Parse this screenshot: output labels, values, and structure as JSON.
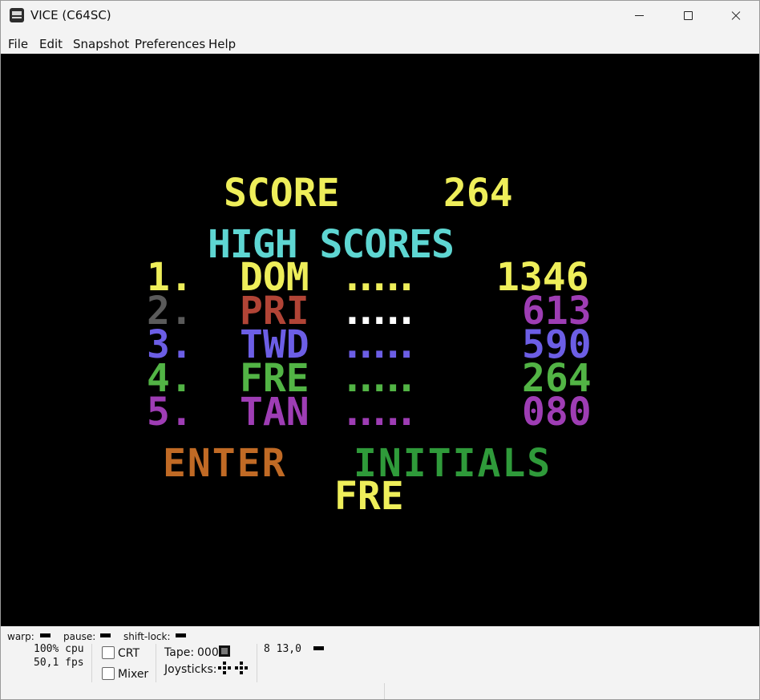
{
  "window": {
    "title": "VICE (C64SC)"
  },
  "menu": [
    "File",
    "Edit",
    "Snapshot",
    "Preferences",
    "Help"
  ],
  "screen": {
    "score_label": "SCORE",
    "score_value": "264",
    "heading": "HIGH SCORES",
    "rows": [
      {
        "rank": "1.",
        "name": "DOM",
        "dots": ".....",
        "score": "1346"
      },
      {
        "rank": "2.",
        "name": "PRI",
        "dots": ".....",
        "score": "613"
      },
      {
        "rank": "3.",
        "name": "TWD",
        "dots": ".....",
        "score": "590"
      },
      {
        "rank": "4.",
        "name": "FRE",
        "dots": ".....",
        "score": "264"
      },
      {
        "rank": "5.",
        "name": "TAN",
        "dots": ".....",
        "score": "080"
      }
    ],
    "prompt_part1": "ENTER",
    "prompt_part2": "INITIALS",
    "entry": "FRE"
  },
  "colors": {
    "yellow": "#eeee5a",
    "cyan": "#5ed6d2",
    "grey": "#5a5a5a",
    "red": "#b14436",
    "white": "#ffffff",
    "blue": "#6c5ee5",
    "green": "#52b445",
    "purple": "#9e3db4",
    "orange": "#c06a25",
    "dark_green": "#2f9a3a"
  },
  "status": {
    "warp_label": "warp:",
    "pause_label": "pause:",
    "shiftlock_label": "shift-lock:",
    "cpu": "100% cpu",
    "fps": "50,1 fps",
    "crt_label": "CRT",
    "mixer_label": "Mixer",
    "tape_label": "Tape:",
    "tape_counter": "000",
    "joysticks_label": "Joysticks:",
    "drive_status": "8 13,0"
  }
}
